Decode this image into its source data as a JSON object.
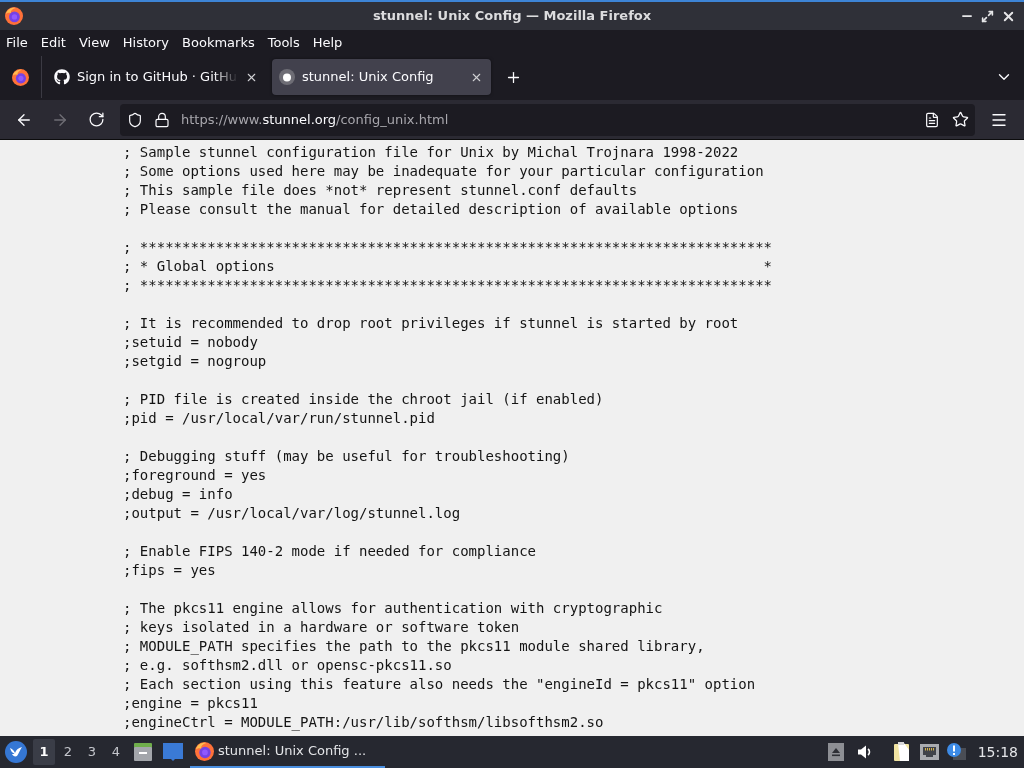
{
  "window": {
    "title": "stunnel: Unix Config — Mozilla Firefox"
  },
  "menu": [
    {
      "label": "File"
    },
    {
      "label": "Edit"
    },
    {
      "label": "View"
    },
    {
      "label": "History"
    },
    {
      "label": "Bookmarks"
    },
    {
      "label": "Tools"
    },
    {
      "label": "Help"
    }
  ],
  "tabs": [
    {
      "kind": "github",
      "title": "Sign in to GitHub · GitHu",
      "selected": false
    },
    {
      "kind": "site",
      "title": "stunnel: Unix Config",
      "selected": true
    }
  ],
  "nav_buttons": [
    {
      "kind": "back",
      "disabled": false
    },
    {
      "kind": "forward",
      "disabled": true
    },
    {
      "kind": "reload",
      "disabled": false
    }
  ],
  "address_bar": {
    "scheme": "https://www.",
    "domain": "stunnel.org",
    "path": "/config_unix.html"
  },
  "page": {
    "blocks": [
      [
        "; Sample stunnel configuration file for Unix by Michal Trojnara 1998-2022",
        "; Some options used here may be inadequate for your particular configuration",
        "; This sample file does *not* represent stunnel.conf defaults",
        "; Please consult the manual for detailed description of available options"
      ],
      [
        "; ***************************************************************************",
        "; * Global options                                                          *",
        "; ***************************************************************************"
      ],
      [
        "; It is recommended to drop root privileges if stunnel is started by root",
        ";setuid = nobody",
        ";setgid = nogroup"
      ],
      [
        "; PID file is created inside the chroot jail (if enabled)",
        ";pid = /usr/local/var/run/stunnel.pid"
      ],
      [
        "; Debugging stuff (may be useful for troubleshooting)",
        ";foreground = yes",
        ";debug = info",
        ";output = /usr/local/var/log/stunnel.log"
      ],
      [
        "; Enable FIPS 140-2 mode if needed for compliance",
        ";fips = yes"
      ],
      [
        "; The pkcs11 engine allows for authentication with cryptographic",
        "; keys isolated in a hardware or software token",
        "; MODULE_PATH specifies the path to the pkcs11 module shared library,",
        "; e.g. softhsm2.dll or opensc-pkcs11.so",
        "; Each section using this feature also needs the \"engineId = pkcs11\" option",
        ";engine = pkcs11",
        ";engineCtrl = MODULE_PATH:/usr/lib/softhsm/libsofthsm2.so"
      ]
    ]
  },
  "taskbar": {
    "workspaces": [
      {
        "label": "1",
        "selected": true
      },
      {
        "label": "2",
        "selected": false
      },
      {
        "label": "3",
        "selected": false
      },
      {
        "label": "4",
        "selected": false
      }
    ],
    "windows": [
      {
        "title": "stunnel: Unix Config ...",
        "selected": true
      }
    ],
    "clock": "15:18"
  }
}
